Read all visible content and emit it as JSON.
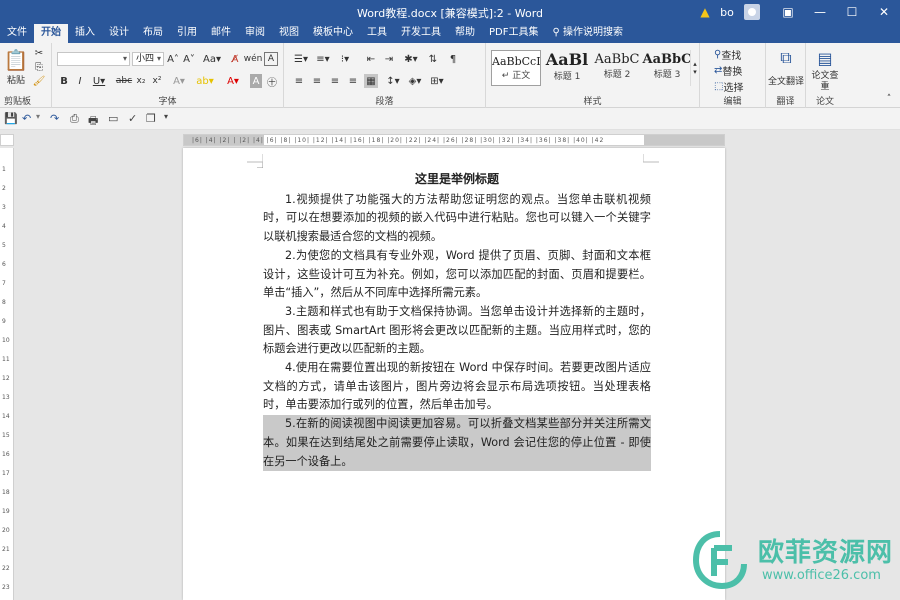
{
  "window": {
    "title": "Word教程.docx [兼容模式]:2  -  Word",
    "user": "bo"
  },
  "menu": [
    "文件",
    "开始",
    "插入",
    "设计",
    "布局",
    "引用",
    "邮件",
    "审阅",
    "视图",
    "模板中心",
    "工具",
    "开发工具",
    "帮助",
    "PDF工具集",
    "操作说明搜索"
  ],
  "ribbon": {
    "clipboard": {
      "paste": "粘贴",
      "label": "剪贴板"
    },
    "font": {
      "font_name": "",
      "font_size": "小四",
      "label": "字体"
    },
    "paragraph": {
      "label": "段落"
    },
    "styles": {
      "label": "样式",
      "items": [
        {
          "preview": "AaBbCcI",
          "name": "↵ 正文"
        },
        {
          "preview": "AaBl",
          "name": "标题 1"
        },
        {
          "preview": "AaBbC",
          "name": "标题 2"
        },
        {
          "preview": "AaBbC",
          "name": "标题 3"
        }
      ]
    },
    "editing": {
      "find": "查找",
      "replace": "替换",
      "select": "选择",
      "label": "编辑"
    },
    "translate": {
      "button": "全文翻译",
      "label": "翻译"
    },
    "paper": {
      "button": "论文查重",
      "label": "论文"
    }
  },
  "ruler": {
    "ticks": "|6| |4| |2| | |2| |4| |6| |8| |10| |12| |14| |16| |18| |20| |22| |24| |26| |28| |30| |32| |34| |36| |38| |40| |42"
  },
  "vruler": [
    "1",
    "2",
    "3",
    "4",
    "5",
    "6",
    "7",
    "8",
    "9",
    "10",
    "11",
    "12",
    "13",
    "14",
    "15",
    "16",
    "17",
    "18",
    "19",
    "20",
    "21",
    "22",
    "23"
  ],
  "document": {
    "title": "这里是举例标题",
    "paragraphs": [
      "1.视频提供了功能强大的方法帮助您证明您的观点。当您单击联机视频时，可以在想要添加的视频的嵌入代码中进行粘贴。您也可以键入一个关键字以联机搜索最适合您的文档的视频。",
      "2.为使您的文档具有专业外观，Word 提供了页眉、页脚、封面和文本框设计，这些设计可互为补充。例如，您可以添加匹配的封面、页眉和提要栏。单击“插入”，然后从不同库中选择所需元素。",
      "3.主题和样式也有助于文档保持协调。当您单击设计并选择新的主题时，图片、图表或 SmartArt 图形将会更改以匹配新的主题。当应用样式时，您的标题会进行更改以匹配新的主题。",
      "4.使用在需要位置出现的新按钮在 Word 中保存时间。若要更改图片适应文档的方式，请单击该图片，图片旁边将会显示布局选项按钮。当处理表格时，单击要添加行或列的位置，然后单击加号。"
    ],
    "highlighted": "5.在新的阅读视图中阅读更加容易。可以折叠文档某些部分并关注所需文本。如果在达到结尾处之前需要停止读取，Word 会记住您的停止位置 - 即使在另一个设备上。"
  },
  "watermark": {
    "name": "欧菲资源网",
    "url": "www.office26.com"
  }
}
